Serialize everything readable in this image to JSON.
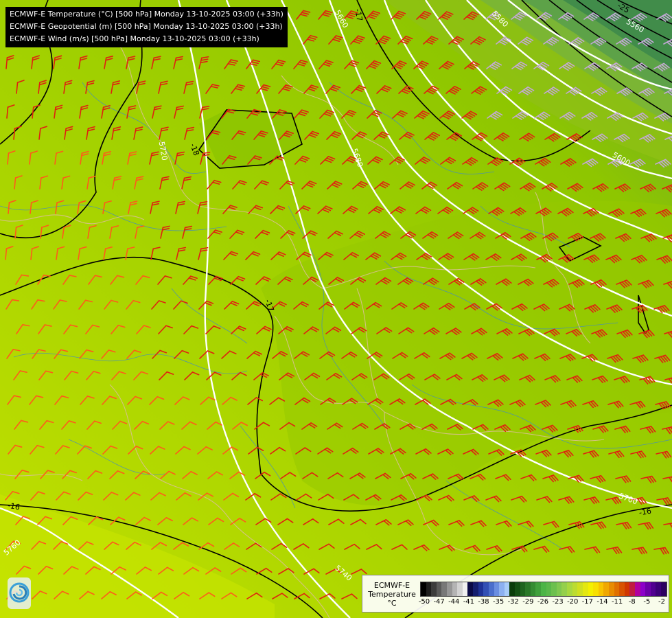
{
  "titles": [
    "ECMWF-E Temperature (°C) [500 hPa] Monday 13-10-2025 03:00 (+33h)",
    "ECMWF-E Geopotential (m) [500 hPa] Monday 13-10-2025 03:00 (+33h)",
    "ECMWF-E Wind (m/s) [500 hPa] Monday 13-10-2025 03:00 (+33h)"
  ],
  "legend": {
    "title_line1": "ECMWF-E",
    "title_line2": "Temperature",
    "unit": "°C",
    "ticks": [
      "-50",
      "-47",
      "-44",
      "-41",
      "-38",
      "-35",
      "-32",
      "-29",
      "-26",
      "-23",
      "-20",
      "-17",
      "-14",
      "-11",
      "-8",
      "-5",
      "-2"
    ],
    "colors": [
      "#000000",
      "#1e1e1e",
      "#3c3c3c",
      "#5a5a5a",
      "#787878",
      "#969696",
      "#b4b4b4",
      "#d2d2d2",
      "#f0f0f0",
      "#0a0a46",
      "#141e6e",
      "#1e3296",
      "#3250b4",
      "#4a6ecc",
      "#6a8ee0",
      "#8cb0f0",
      "#a8ccf8",
      "#0a3c0a",
      "#145014",
      "#1e641e",
      "#2a7828",
      "#348c32",
      "#40a03c",
      "#4cb446",
      "#5ab84a",
      "#6cc04e",
      "#80c850",
      "#94d04c",
      "#a8d840",
      "#bcdc30",
      "#d0e020",
      "#e4e810",
      "#f4f000",
      "#f8e000",
      "#f8c400",
      "#f0a800",
      "#e88c00",
      "#e07000",
      "#d85400",
      "#d03800",
      "#c01c40",
      "#b000a0",
      "#8c00c8",
      "#6c00a8",
      "#500090",
      "#3c0078",
      "#2c0060"
    ]
  },
  "contours": {
    "geopotential": [
      "5560",
      "5580",
      "5600",
      "5660",
      "5680",
      "5700",
      "5720",
      "5740",
      "5760"
    ],
    "temperature": [
      "-17",
      "-18",
      "-17",
      "-16",
      "-16",
      "-25"
    ]
  },
  "colors": {
    "background": "#a9d400",
    "barb_red": "#e02010",
    "barb_orange": "#ff5a1a",
    "barb_lavender": "#c4a8d8",
    "geopotential_line": "#ffffff",
    "temperature_line": "#000000",
    "border_line": "#d8c090"
  },
  "icons": {
    "logo": "ecmwf-swirl-logo"
  }
}
